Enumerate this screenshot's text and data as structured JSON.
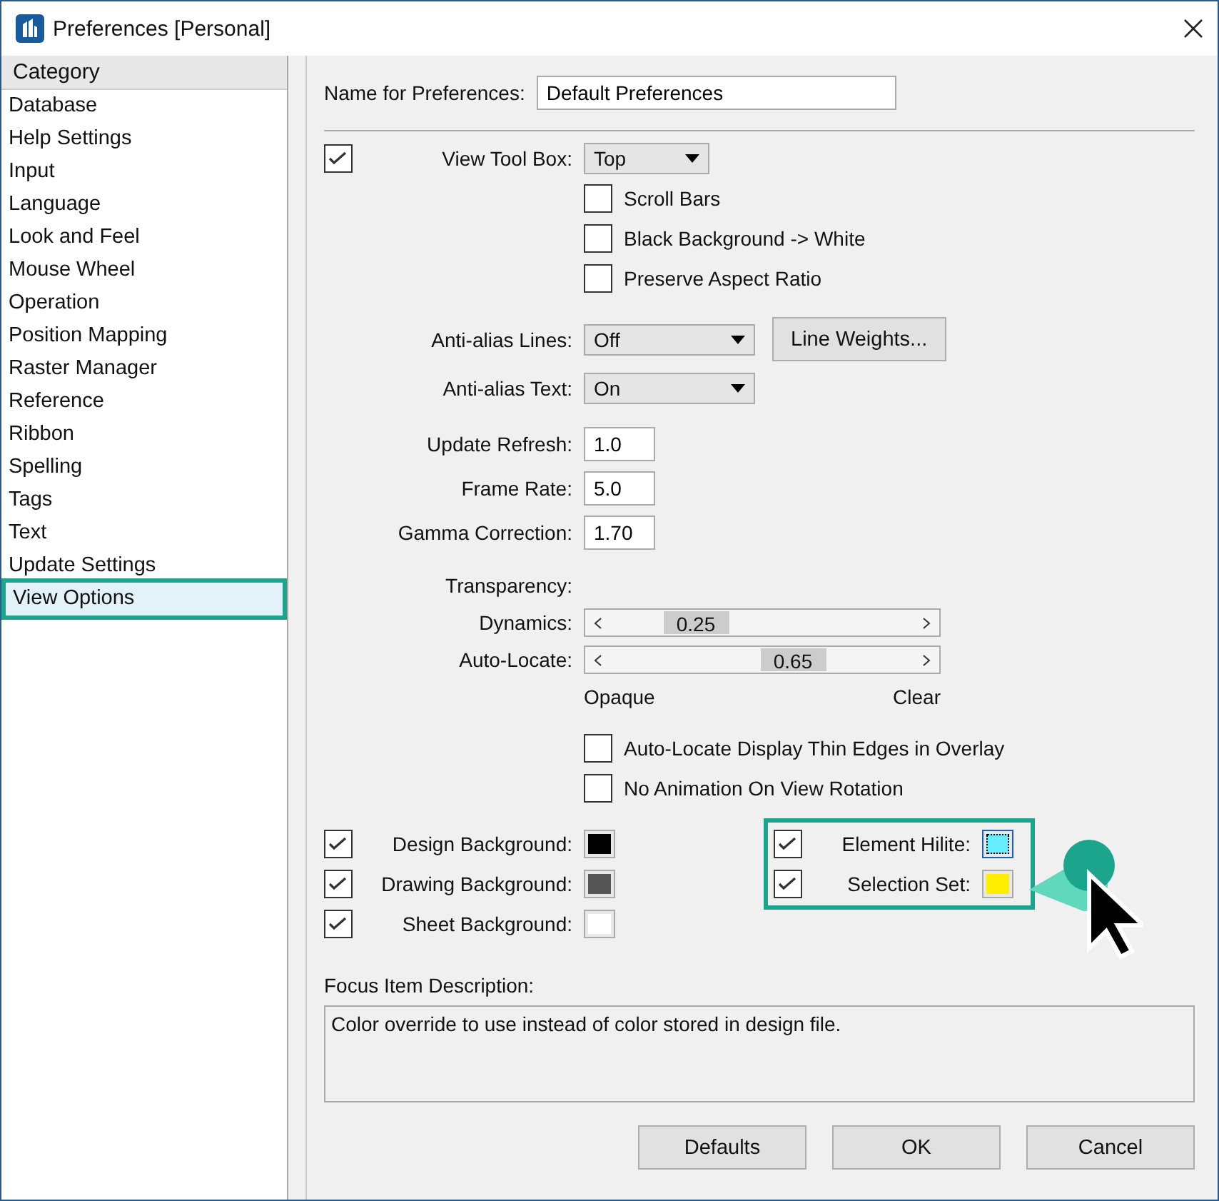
{
  "window": {
    "title": "Preferences [Personal]"
  },
  "sidebar": {
    "header": "Category",
    "items": [
      {
        "label": "Database",
        "selected": false
      },
      {
        "label": "Help Settings",
        "selected": false
      },
      {
        "label": "Input",
        "selected": false
      },
      {
        "label": "Language",
        "selected": false
      },
      {
        "label": "Look and Feel",
        "selected": false
      },
      {
        "label": "Mouse Wheel",
        "selected": false
      },
      {
        "label": "Operation",
        "selected": false
      },
      {
        "label": "Position Mapping",
        "selected": false
      },
      {
        "label": "Raster Manager",
        "selected": false
      },
      {
        "label": "Reference",
        "selected": false
      },
      {
        "label": "Ribbon",
        "selected": false
      },
      {
        "label": "Spelling",
        "selected": false
      },
      {
        "label": "Tags",
        "selected": false
      },
      {
        "label": "Text",
        "selected": false
      },
      {
        "label": "Update Settings",
        "selected": false
      },
      {
        "label": "View Options",
        "selected": true
      }
    ]
  },
  "name_field": {
    "label": "Name for Preferences:",
    "value": "Default Preferences"
  },
  "view_tool_box": {
    "checked": true,
    "label": "View Tool Box:",
    "value": "Top"
  },
  "tool_box_options": [
    {
      "label": "Scroll Bars",
      "checked": false
    },
    {
      "label": "Black Background -> White",
      "checked": false
    },
    {
      "label": "Preserve Aspect Ratio",
      "checked": false
    }
  ],
  "anti_alias": [
    {
      "label": "Anti-alias Lines:",
      "value": "Off"
    },
    {
      "label": "Anti-alias Text:",
      "value": "On"
    }
  ],
  "line_weights_button": "Line Weights...",
  "number_fields": [
    {
      "label": "Update Refresh:",
      "value": "1.0"
    },
    {
      "label": "Frame Rate:",
      "value": "5.0"
    },
    {
      "label": "Gamma Correction:",
      "value": "1.70"
    }
  ],
  "transparency": {
    "label": "Transparency:",
    "sliders": [
      {
        "label": "Dynamics:",
        "level": 0.25,
        "reading": "0.25"
      },
      {
        "label": "Auto-Locate:",
        "level": 0.65,
        "reading": "0.65"
      }
    ],
    "min_label": "Opaque",
    "max_label": "Clear"
  },
  "overlay_options": [
    {
      "label": "Auto-Locate Display Thin Edges in Overlay",
      "checked": false
    },
    {
      "label": "No Animation On View Rotation",
      "checked": false
    }
  ],
  "backgrounds": [
    {
      "label": "Design Background:",
      "checked": true,
      "color": "#000000"
    },
    {
      "label": "Drawing Background:",
      "checked": true,
      "color": "#555555"
    },
    {
      "label": "Sheet Background:",
      "checked": true,
      "color": "#ffffff"
    }
  ],
  "highlights": [
    {
      "label": "Element Hilite:",
      "checked": true,
      "color": "#66eeff",
      "focused": true
    },
    {
      "label": "Selection Set:",
      "checked": true,
      "color": "#ffee00",
      "focused": false
    }
  ],
  "focus_description": {
    "label": "Focus Item Description:",
    "text": "Color override to use instead of color stored in design file."
  },
  "buttons": [
    "Defaults",
    "OK",
    "Cancel"
  ]
}
